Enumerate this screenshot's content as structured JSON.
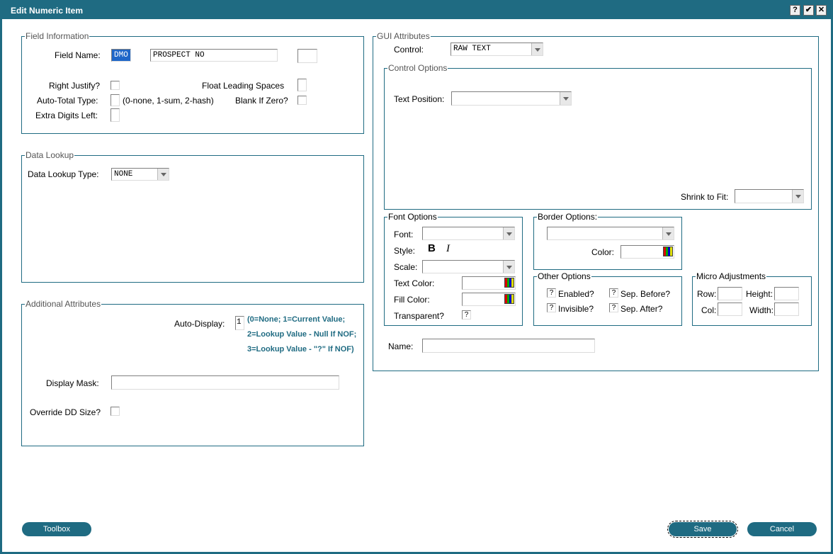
{
  "window": {
    "title": "Edit Numeric Item",
    "help_glyph": "?",
    "ok_glyph": "✔",
    "close_glyph": "✕"
  },
  "field_info": {
    "legend": "Field Information",
    "field_name_label": "Field Name:",
    "file_prefix": "DMO",
    "field_name_value": "PROSPECT NO",
    "extra_value": "",
    "right_justify_label": "Right Justify?",
    "float_leading_label": "Float Leading Spaces",
    "auto_total_label": "Auto-Total Type:",
    "auto_total_hint": "(0-none, 1-sum, 2-hash)",
    "blank_if_zero_label": "Blank If Zero?",
    "extra_digits_label": "Extra Digits Left:"
  },
  "data_lookup": {
    "legend": "Data Lookup",
    "type_label": "Data Lookup Type:",
    "type_value": "NONE"
  },
  "additional": {
    "legend": "Additional Attributes",
    "auto_display_label": "Auto-Display:",
    "auto_display_value": "1",
    "auto_display_note_1": "(0=None; 1=Current Value;",
    "auto_display_note_2": "2=Lookup Value - Null If NOF;",
    "auto_display_note_3": "3=Lookup Value - \"?\" If NOF)",
    "display_mask_label": "Display Mask:",
    "display_mask_value": "",
    "override_label": "Override DD Size?"
  },
  "gui": {
    "legend": "GUI Attributes",
    "control_label": "Control:",
    "control_value": "RAW TEXT",
    "control_options_legend": "Control Options",
    "text_position_label": "Text Position:",
    "shrink_label": "Shrink to Fit:",
    "font_legend": "Font Options",
    "font_label": "Font:",
    "style_label": "Style:",
    "bold_glyph": "B",
    "italic_glyph": "I",
    "scale_label": "Scale:",
    "text_color_label": "Text Color:",
    "fill_color_label": "Fill Color:",
    "transparent_label": "Transparent?",
    "transparent_value": "?",
    "border_legend": "Border Options:",
    "border_color_label": "Color:",
    "other_legend": "Other Options",
    "enabled_label": "Enabled?",
    "enabled_value": "?",
    "sep_before_label": "Sep. Before?",
    "sep_before_value": "?",
    "invisible_label": "Invisible?",
    "invisible_value": "?",
    "sep_after_label": "Sep. After?",
    "sep_after_value": "?",
    "micro_legend": "Micro Adjustments",
    "row_label": "Row:",
    "height_label": "Height:",
    "col_label": "Col:",
    "width_label": "Width:",
    "name_label": "Name:",
    "name_value": ""
  },
  "buttons": {
    "toolbox": "Toolbox",
    "save": "Save",
    "cancel": "Cancel"
  },
  "colors": {
    "accent": "#1f6b82",
    "note_text": "#1f6b82",
    "selection": "#1e66c8"
  },
  "icons": {
    "color_picker": "color-picker-icon",
    "dropdown": "chevron-down-icon"
  }
}
